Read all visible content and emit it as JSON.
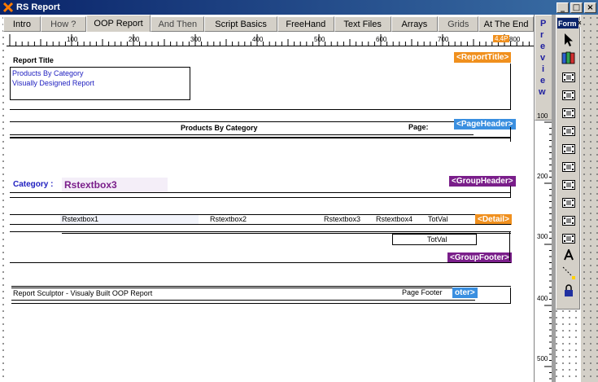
{
  "window": {
    "title": "RS Report",
    "minimize": "_",
    "maximize": "□",
    "close": "×"
  },
  "tabs": [
    {
      "label": "Intro",
      "active": false
    },
    {
      "label": "How ?",
      "active": false
    },
    {
      "label": "OOP Report",
      "active": true
    },
    {
      "label": "And Then",
      "active": false
    },
    {
      "label": "Script Basics",
      "active": false
    },
    {
      "label": "FreeHand",
      "active": false
    },
    {
      "label": "Text Files",
      "active": false
    },
    {
      "label": "Arrays",
      "active": false
    },
    {
      "label": "Grids",
      "active": false
    },
    {
      "label": "At The End",
      "active": false
    }
  ],
  "ruler": {
    "labels": [
      "100",
      "200",
      "300",
      "400",
      "500",
      "600",
      "700",
      "800"
    ],
    "marker": "4.4P"
  },
  "report": {
    "title_band": {
      "label": "Report Title",
      "line1": "Products By Category",
      "line2": "Visually Designed Report",
      "tag": "<ReportTitle>"
    },
    "page_header": {
      "center": "Products By Category",
      "page": "Page:",
      "tag": "<PageHeader>"
    },
    "group_header": {
      "label": "Category :",
      "field": "Rstextbox3",
      "tag": "<GroupHeader>"
    },
    "detail": {
      "f1": "Rstextbox1",
      "f2": "Rstextbox2",
      "f3": "Rstextbox3",
      "f4": "Rstextbox4",
      "f5": "TotVal",
      "tag": "<Detail>"
    },
    "group_footer": {
      "total": "TotVal",
      "tag": "<GroupFooter>"
    },
    "page_footer": {
      "left": "Report Sculptor - Visualy Built OOP Report",
      "right": "Page Footer",
      "tag": "oter>"
    }
  },
  "preview": {
    "letters": [
      "P",
      "r",
      "e",
      "v",
      "i",
      "e",
      "w"
    ],
    "vruler": [
      "100",
      "200",
      "300",
      "400",
      "500"
    ]
  },
  "toolbox": {
    "title": "Form",
    "close": "x"
  },
  "colors": {
    "tag_orange": "#f0901e",
    "tag_blue": "#3a8fe0",
    "tag_purple": "#7a1e8a",
    "title_blue": "#2020c0",
    "group_purple": "#7a1e8a"
  }
}
